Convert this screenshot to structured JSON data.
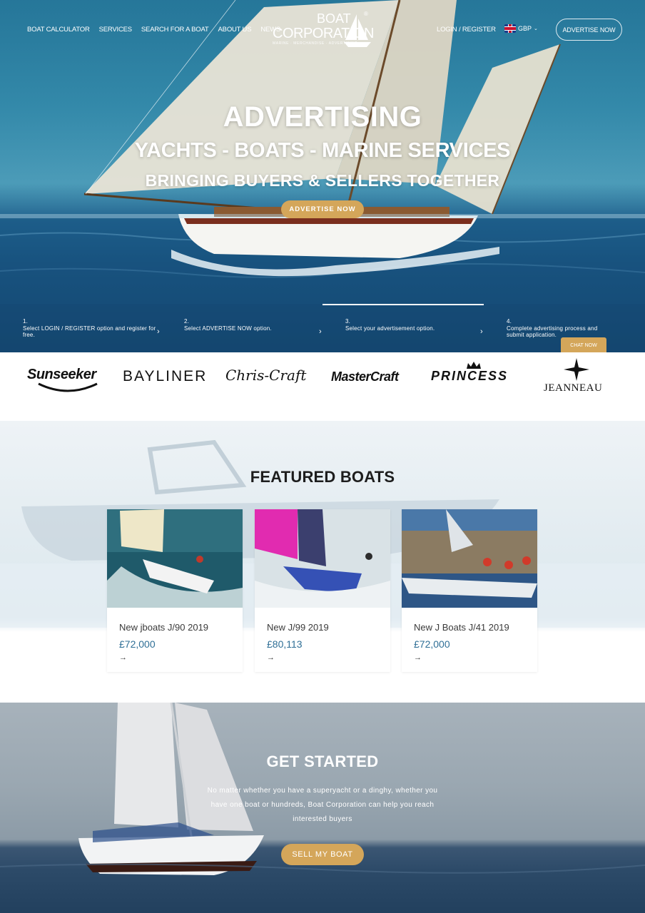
{
  "nav": {
    "items": [
      "BOAT CALCULATOR",
      "SERVICES",
      "SEARCH FOR A BOAT",
      "ABOUT US",
      "NEWS"
    ],
    "login": "LOGIN / REGISTER",
    "currency": "GBP",
    "advertise_button": "ADVERTISE NOW"
  },
  "logo": {
    "line1": "BOAT",
    "line2": "CORPORATION",
    "tagline": "MARINE · MERCHANDISE · ADVERTISING",
    "registered": "®"
  },
  "hero": {
    "title": "ADVERTISING",
    "subtitle": "YACHTS - BOATS - MARINE SERVICES",
    "tagline": "BRINGING BUYERS & SELLERS TOGETHER",
    "button": "ADVERTISE NOW"
  },
  "steps": [
    {
      "number": "1.",
      "text": "Select LOGIN / REGISTER option and register for free."
    },
    {
      "number": "2.",
      "text": "Select ADVERTISE NOW option."
    },
    {
      "number": "3.",
      "text": "Select your advertisement option."
    },
    {
      "number": "4.",
      "text": "Complete advertising process and submit application."
    }
  ],
  "chat": "CHAT NOW",
  "brands": [
    "Sunseeker",
    "BAYLINER",
    "Chris-Craft",
    "MasterCraft",
    "PRINCESS",
    "JEANNEAU"
  ],
  "featured": {
    "title": "FEATURED BOATS",
    "boats": [
      {
        "name": "New jboats J/90 2019",
        "price": "£72,000",
        "arrow": "→"
      },
      {
        "name": "New  J/99 2019",
        "price": "£80,113",
        "arrow": "→"
      },
      {
        "name": "New J Boats J/41 2019",
        "price": "£72,000",
        "arrow": "→"
      }
    ]
  },
  "get_started": {
    "title": "GET STARTED",
    "text": "No matter whether you have a superyacht or a dinghy, whether you have one boat or hundreds, Boat Corporation can help you reach interested buyers",
    "button": "SELL MY BOAT"
  },
  "colors": {
    "accent": "#d4a65a",
    "price": "#2f6f96"
  }
}
